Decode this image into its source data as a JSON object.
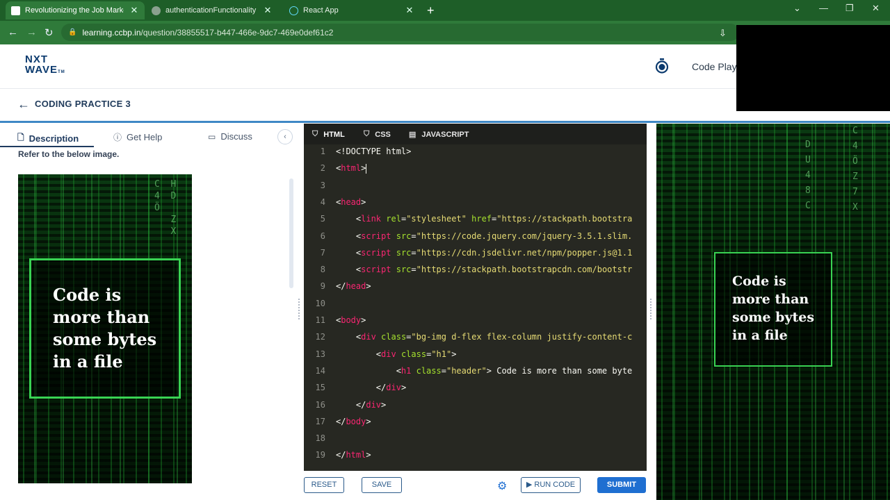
{
  "browser": {
    "tabs": [
      {
        "title": "Revolutionizing the Job Market |",
        "active": true
      },
      {
        "title": "authenticationFunctionality — C",
        "active": false
      },
      {
        "title": "React App",
        "active": false
      }
    ],
    "url_host": "learning.ccbp.in",
    "url_path": "/question/38855517-b447-466e-9dc7-469e0def61c2",
    "icons": [
      "back-arrow-icon",
      "forward-arrow-icon",
      "reload-icon",
      "lock-icon",
      "install-icon"
    ]
  },
  "header": {
    "logo_line1": "NXT",
    "logo_line2": "WAVE",
    "logo_tm": "TM",
    "code_playground": "Code Play"
  },
  "breadcrumb": {
    "title": "CODING PRACTICE 3"
  },
  "description_panel": {
    "tabs": [
      "Description",
      "Get Help",
      "Discuss"
    ],
    "active_tab": "Description",
    "refer_text": "Refer to the below image."
  },
  "preview_image": {
    "text_lines": [
      "Code is",
      "more than",
      "some bytes",
      "in a file"
    ]
  },
  "editor": {
    "tabs": [
      "HTML",
      "CSS",
      "JAVASCRIPT"
    ],
    "active_tab": "HTML",
    "lines": [
      {
        "n": "1",
        "segs": [
          [
            "t",
            "<!DOCTYPE html>"
          ]
        ]
      },
      {
        "n": "2",
        "segs": [
          [
            "t",
            "<"
          ],
          [
            "tag",
            "html"
          ],
          [
            "t",
            ">"
          ],
          [
            "cursor",
            ""
          ]
        ]
      },
      {
        "n": "3",
        "segs": []
      },
      {
        "n": "4",
        "segs": [
          [
            "t",
            "<"
          ],
          [
            "tag",
            "head"
          ],
          [
            "t",
            ">"
          ]
        ]
      },
      {
        "n": "5",
        "segs": [
          [
            "t",
            "    <"
          ],
          [
            "tag",
            "link"
          ],
          [
            "t",
            " "
          ],
          [
            "attr",
            "rel"
          ],
          [
            "t",
            "="
          ],
          [
            "str",
            "\"stylesheet\""
          ],
          [
            "t",
            " "
          ],
          [
            "attr",
            "href"
          ],
          [
            "t",
            "="
          ],
          [
            "str",
            "\"https://stackpath.bootstra"
          ]
        ]
      },
      {
        "n": "6",
        "segs": [
          [
            "t",
            "    <"
          ],
          [
            "tag",
            "script"
          ],
          [
            "t",
            " "
          ],
          [
            "attr",
            "src"
          ],
          [
            "t",
            "="
          ],
          [
            "str",
            "\"https://code.jquery.com/jquery-3.5.1.slim."
          ]
        ]
      },
      {
        "n": "7",
        "segs": [
          [
            "t",
            "    <"
          ],
          [
            "tag",
            "script"
          ],
          [
            "t",
            " "
          ],
          [
            "attr",
            "src"
          ],
          [
            "t",
            "="
          ],
          [
            "str",
            "\"https://cdn.jsdelivr.net/npm/popper.js@1.1"
          ]
        ]
      },
      {
        "n": "8",
        "segs": [
          [
            "t",
            "    <"
          ],
          [
            "tag",
            "script"
          ],
          [
            "t",
            " "
          ],
          [
            "attr",
            "src"
          ],
          [
            "t",
            "="
          ],
          [
            "str",
            "\"https://stackpath.bootstrapcdn.com/bootstr"
          ]
        ]
      },
      {
        "n": "9",
        "segs": [
          [
            "t",
            "</"
          ],
          [
            "tag",
            "head"
          ],
          [
            "t",
            ">"
          ]
        ]
      },
      {
        "n": "10",
        "segs": []
      },
      {
        "n": "11",
        "segs": [
          [
            "t",
            "<"
          ],
          [
            "tag",
            "body"
          ],
          [
            "t",
            ">"
          ]
        ]
      },
      {
        "n": "12",
        "segs": [
          [
            "t",
            "    <"
          ],
          [
            "tag",
            "div"
          ],
          [
            "t",
            " "
          ],
          [
            "attr",
            "class"
          ],
          [
            "t",
            "="
          ],
          [
            "str",
            "\"bg-img d-flex flex-column justify-content-c"
          ]
        ]
      },
      {
        "n": "13",
        "segs": [
          [
            "t",
            "        <"
          ],
          [
            "tag",
            "div"
          ],
          [
            "t",
            " "
          ],
          [
            "attr",
            "class"
          ],
          [
            "t",
            "="
          ],
          [
            "str",
            "\"h1\""
          ],
          [
            "t",
            ">"
          ]
        ]
      },
      {
        "n": "14",
        "segs": [
          [
            "t",
            "            <"
          ],
          [
            "tag",
            "h1"
          ],
          [
            "t",
            " "
          ],
          [
            "attr",
            "class"
          ],
          [
            "t",
            "="
          ],
          [
            "str",
            "\"header\""
          ],
          [
            "t",
            "> Code is more than some byte"
          ]
        ]
      },
      {
        "n": "15",
        "segs": [
          [
            "t",
            "        </"
          ],
          [
            "tag",
            "div"
          ],
          [
            "t",
            ">"
          ]
        ]
      },
      {
        "n": "16",
        "segs": [
          [
            "t",
            "    </"
          ],
          [
            "tag",
            "div"
          ],
          [
            "t",
            ">"
          ]
        ]
      },
      {
        "n": "17",
        "segs": [
          [
            "t",
            "</"
          ],
          [
            "tag",
            "body"
          ],
          [
            "t",
            ">"
          ]
        ]
      },
      {
        "n": "18",
        "segs": []
      },
      {
        "n": "19",
        "segs": [
          [
            "t",
            "</"
          ],
          [
            "tag",
            "html"
          ],
          [
            "t",
            ">"
          ]
        ]
      }
    ]
  },
  "footer_buttons": {
    "reset": "RESET",
    "save": "SAVE",
    "run_code": "RUN CODE",
    "submit": "SUBMIT"
  },
  "output": {
    "text_lines": [
      "Code is",
      "more than",
      "some bytes",
      "in a file"
    ]
  },
  "colors": {
    "browser_green": "#2f7a3a",
    "brand_navy": "#1f3a5a",
    "accent_blue": "#1f6fd1",
    "editor_bg": "#272822",
    "matrix_green": "#39d353"
  }
}
